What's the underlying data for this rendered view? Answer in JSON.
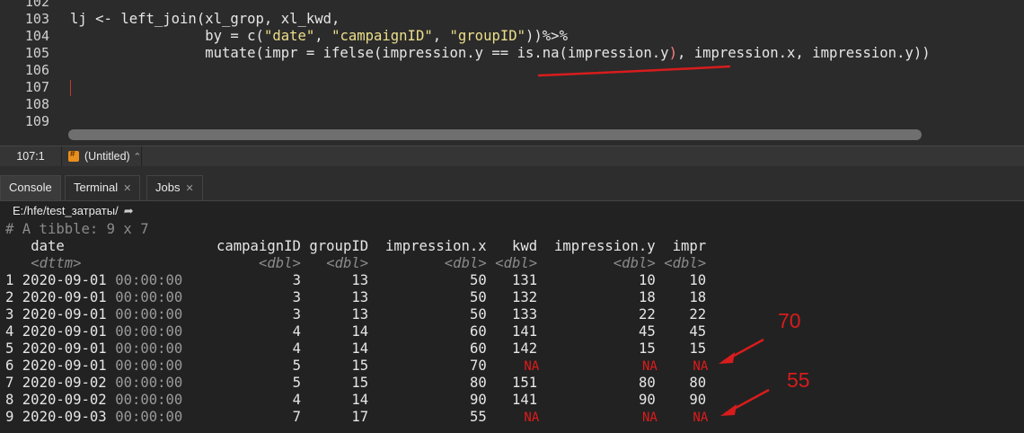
{
  "editor": {
    "line_numbers": [
      "102",
      "103",
      "104",
      "105",
      "106",
      "107",
      "108",
      "109"
    ],
    "code_lines": {
      "l103_a": "lj <- left_join(xl_grop, xl_kwd,",
      "l104_a": "                by = c(",
      "l104_s1": "\"date\"",
      "l104_b": ", ",
      "l104_s2": "\"campaignID\"",
      "l104_c": ", ",
      "l104_s3": "\"groupID\"",
      "l104_d": "))%>%",
      "l105_a": "                mutate(impr = ifelse(impression.y == is.na(impression.y",
      "l105_b": ")",
      "l105_c": ", impression.x, impression.y))"
    }
  },
  "statusbar": {
    "cursor_position": "107:1",
    "file_type_label": "(Untitled)",
    "file_type_arrow": "⌃"
  },
  "tabs": [
    {
      "label": "Console"
    },
    {
      "label": "Terminal"
    },
    {
      "label": "Jobs"
    }
  ],
  "console": {
    "path": "E:/hfe/test_затраты/",
    "tibble_header": "# A tibble: 9 x 7",
    "columns": [
      "date",
      "campaignID",
      "groupID",
      "impression.x",
      "kwd",
      "impression.y",
      "impr"
    ],
    "types": [
      "<dttm>",
      "<dbl>",
      "<dbl>",
      "<dbl>",
      "<dbl>",
      "<dbl>",
      "<dbl>"
    ],
    "rows": [
      {
        "n": "1",
        "date": "2020-09-01",
        "time": "00:00:00",
        "campaignID": "3",
        "groupID": "13",
        "impression_x": "50",
        "kwd": "131",
        "impression_y": "10",
        "impr": "10"
      },
      {
        "n": "2",
        "date": "2020-09-01",
        "time": "00:00:00",
        "campaignID": "3",
        "groupID": "13",
        "impression_x": "50",
        "kwd": "132",
        "impression_y": "18",
        "impr": "18"
      },
      {
        "n": "3",
        "date": "2020-09-01",
        "time": "00:00:00",
        "campaignID": "3",
        "groupID": "13",
        "impression_x": "50",
        "kwd": "133",
        "impression_y": "22",
        "impr": "22"
      },
      {
        "n": "4",
        "date": "2020-09-01",
        "time": "00:00:00",
        "campaignID": "4",
        "groupID": "14",
        "impression_x": "60",
        "kwd": "141",
        "impression_y": "45",
        "impr": "45"
      },
      {
        "n": "5",
        "date": "2020-09-01",
        "time": "00:00:00",
        "campaignID": "4",
        "groupID": "14",
        "impression_x": "60",
        "kwd": "142",
        "impression_y": "15",
        "impr": "15"
      },
      {
        "n": "6",
        "date": "2020-09-01",
        "time": "00:00:00",
        "campaignID": "5",
        "groupID": "15",
        "impression_x": "70",
        "kwd": "NA",
        "impression_y": "NA",
        "impr": "NA"
      },
      {
        "n": "7",
        "date": "2020-09-02",
        "time": "00:00:00",
        "campaignID": "5",
        "groupID": "15",
        "impression_x": "80",
        "kwd": "151",
        "impression_y": "80",
        "impr": "80"
      },
      {
        "n": "8",
        "date": "2020-09-02",
        "time": "00:00:00",
        "campaignID": "4",
        "groupID": "14",
        "impression_x": "90",
        "kwd": "141",
        "impression_y": "90",
        "impr": "90"
      },
      {
        "n": "9",
        "date": "2020-09-03",
        "time": "00:00:00",
        "campaignID": "7",
        "groupID": "17",
        "impression_x": "55",
        "kwd": "NA",
        "impression_y": "NA",
        "impr": "NA"
      }
    ]
  },
  "annotations": {
    "label_1": "70",
    "label_2": "55",
    "color": "#d81c1c"
  },
  "colors": {
    "na_red": "#e01b1b",
    "string_yellow": "#eddf8a",
    "paren_red": "#ff8080"
  }
}
